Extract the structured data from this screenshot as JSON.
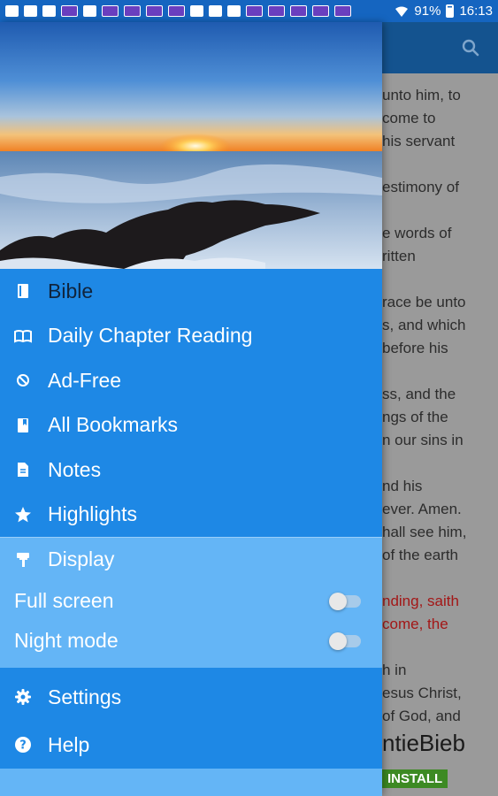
{
  "status_bar": {
    "battery_percent": "91%",
    "time": "16:13"
  },
  "drawer": {
    "header_image": "sunrise-over-clouds",
    "menu": [
      {
        "label": "Bible",
        "icon": "book-icon"
      },
      {
        "label": "Daily Chapter Reading",
        "icon": "open-book-icon"
      },
      {
        "label": "Ad-Free",
        "icon": "no-ads-icon"
      },
      {
        "label": "All Bookmarks",
        "icon": "bookmark-icon"
      },
      {
        "label": "Notes",
        "icon": "note-icon"
      },
      {
        "label": "Highlights",
        "icon": "star-icon"
      }
    ],
    "display": {
      "label": "Display",
      "icon": "paint-roller-icon",
      "full_screen": {
        "label": "Full screen",
        "on": false
      },
      "night_mode": {
        "label": "Night mode",
        "on": false
      }
    },
    "bottom_menu": [
      {
        "label": "Settings",
        "icon": "gear-icon"
      },
      {
        "label": "Help",
        "icon": "help-icon"
      }
    ]
  },
  "background": {
    "lines": [
      "unto him, to",
      "come to",
      "his servant",
      "estimony of",
      "e words of",
      "ritten",
      "race be unto",
      "s, and which",
      "before his",
      "ss, and the",
      "ngs of the",
      "n our sins in",
      "nd his",
      "ever. Amen.",
      "hall see him,",
      "of the earth",
      "nding, saith",
      "come, the",
      "h in",
      "esus Christ,",
      "of God, and"
    ],
    "ad_title": "ntieBieb",
    "ad_button": "INSTALL"
  },
  "colors": {
    "drawer": "#1e88e5",
    "display_section": "#64b5f6",
    "toolbar": "#14538f"
  }
}
